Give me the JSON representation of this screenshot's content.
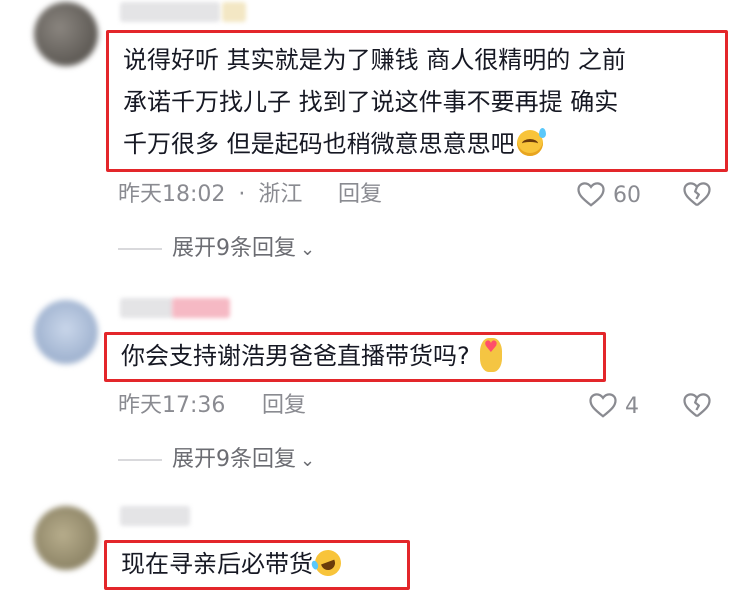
{
  "comments": [
    {
      "lines": [
        "说得好听 其实就是为了赚钱 商人很精明的 之前",
        "承诺千万找儿子 找到了说这件事不要再提 确实",
        "千万很多 但是起码也稍微意思意思吧"
      ],
      "emoji": "sweat-smile-icon",
      "time": "昨天18:02",
      "separator": "·",
      "location": "浙江",
      "reply_label": "回复",
      "likes": "60",
      "expand": "展开9条回复"
    },
    {
      "lines": [
        "你会支持谢浩男爸爸直播带货吗?"
      ],
      "emoji": "finger-heart-icon",
      "time": "昨天17:36",
      "reply_label": "回复",
      "likes": "4",
      "expand": "展开9条回复"
    },
    {
      "lines": [
        "现在寻亲后必带货"
      ],
      "emoji": "rolling-laugh-icon"
    }
  ],
  "colors": {
    "highlight_border": "#e3262a",
    "meta_text": "#8a8b91"
  }
}
